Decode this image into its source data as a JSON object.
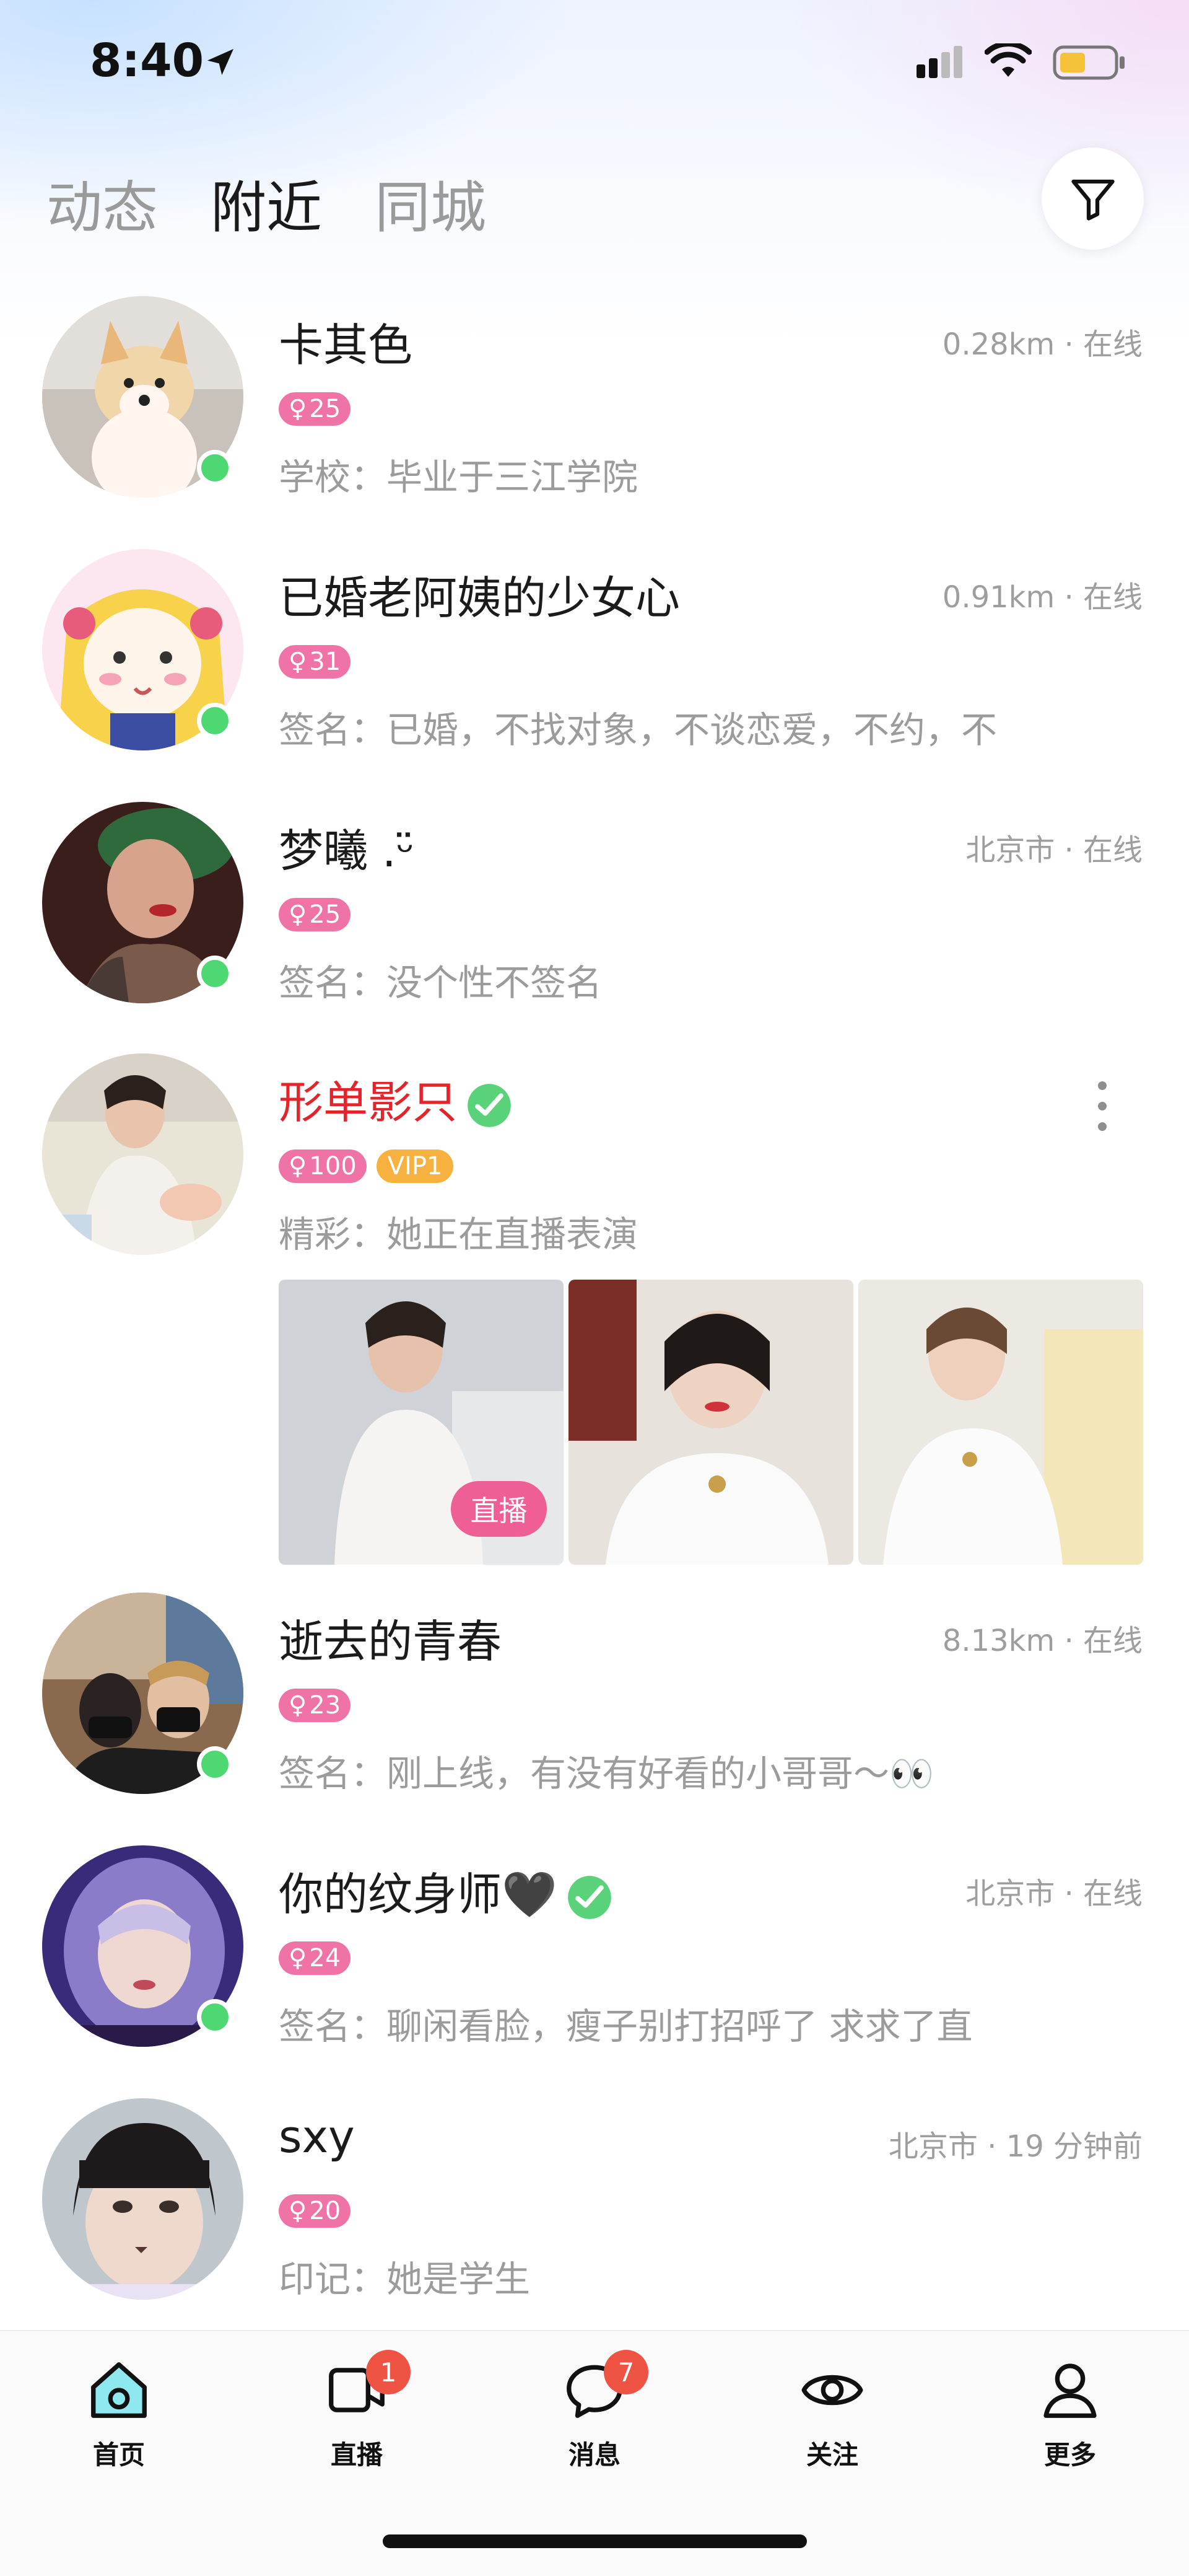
{
  "status": {
    "time": "8:40"
  },
  "top_tabs": [
    {
      "label": "动态"
    },
    {
      "label": "附近"
    },
    {
      "label": "同城"
    }
  ],
  "active_tab": "附近",
  "users": [
    {
      "name": "卡其色",
      "meta": "0.28km · 在线",
      "age": "25",
      "desc": "学校：毕业于三江学院"
    },
    {
      "name": "已婚老阿姨的少女心",
      "meta": "0.91km · 在线",
      "age": "31",
      "desc": "签名：已婚，不找对象，不谈恋爱，不约，不"
    },
    {
      "name": "梦曦 .ᵕ̈",
      "meta": "北京市 · 在线",
      "age": "25",
      "desc": "签名：没个性不签名"
    },
    {
      "name": "形单影只",
      "age": "100",
      "vip": "VIP1",
      "desc": "精彩：她正在直播表演",
      "live_label": "直播"
    },
    {
      "name": "逝去的青春",
      "meta": "8.13km · 在线",
      "age": "23",
      "desc": "签名：刚上线，有没有好看的小哥哥～👀"
    },
    {
      "name": "你的纹身师🖤",
      "meta": "北京市 · 在线",
      "age": "24",
      "desc": "签名：聊闲看脸，瘦子别打招呼了 求求了直"
    },
    {
      "name": "sxy",
      "meta": "北京市 · 19 分钟前",
      "age": "20",
      "desc": "印记：她是学生"
    }
  ],
  "bottom_nav": [
    {
      "label": "首页",
      "icon": "home-icon"
    },
    {
      "label": "直播",
      "icon": "live-icon",
      "badge": "1"
    },
    {
      "label": "消息",
      "icon": "message-icon",
      "badge": "7"
    },
    {
      "label": "关注",
      "icon": "eye-icon"
    },
    {
      "label": "更多",
      "icon": "profile-icon"
    }
  ],
  "colors": {
    "online": "#4ed872",
    "age_badge": "#ef73a6",
    "vip_badge": "#f6b13f",
    "nav_badge": "#ee5343",
    "highlight_name": "#e3242b"
  }
}
